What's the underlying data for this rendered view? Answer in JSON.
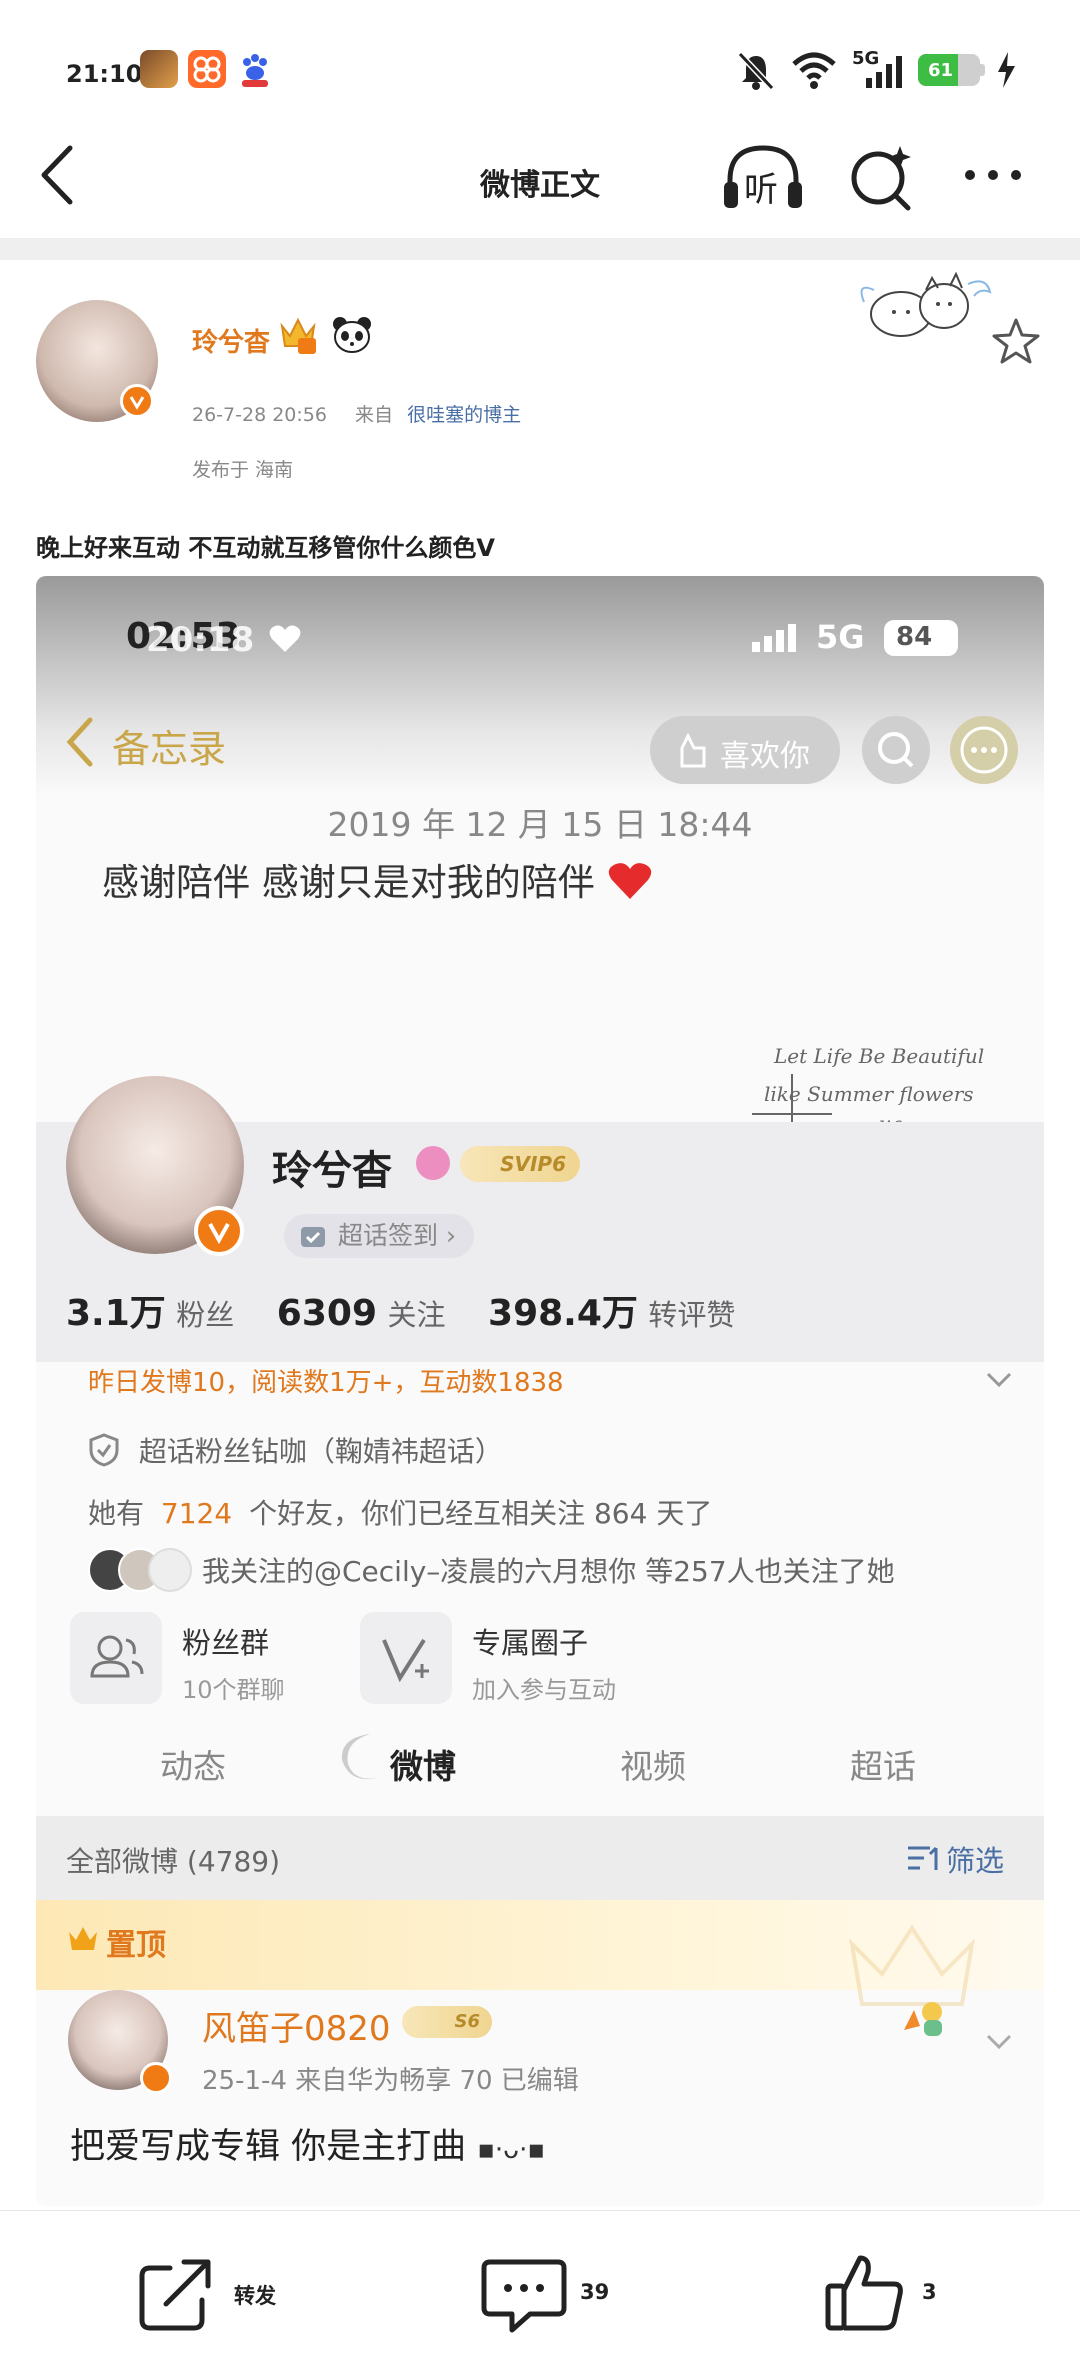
{
  "status_bar": {
    "time": "21:10",
    "network": "5G",
    "battery": "61",
    "app_icons": [
      "game-app-icon",
      "orange-app-icon",
      "baidu-app-icon"
    ],
    "status_icons": [
      "mute-icon",
      "wifi-icon",
      "signal-icon",
      "battery-icon",
      "charging-icon"
    ]
  },
  "nav": {
    "title": "微博正文",
    "listen_label": "听"
  },
  "post": {
    "username": "玲兮杳",
    "date": "26-7-28 20:56",
    "source_prefix": "来自",
    "source": "很哇塞的博主",
    "location": "发布于 海南",
    "text": "晚上好来互动 不互动就互移管你什么颜色V"
  },
  "screenshot": {
    "status_time": "02:53",
    "status_time_overlay": "20:18",
    "network": "5G",
    "battery": "84",
    "back_label": "备忘录",
    "like_button": "喜欢你",
    "memo_date": "2019 年 12 月 15 日 18:44",
    "memo_text": "感谢陪伴 感谢只是对我的陪伴",
    "handwriting": [
      "Let Life Be Beautiful",
      "like Summer flowers",
      "a life"
    ],
    "profile": {
      "name": "玲兮杳",
      "svip": "SVIP6",
      "checkin": "超话签到 ›",
      "fans_num": "3.1万",
      "fans_label": "粉丝",
      "follow_num": "6309",
      "follow_label": "关注",
      "likes_num": "398.4万",
      "likes_label": "转评赞",
      "activity": "昨日发博10，阅读数1万+，互动数1838",
      "supertopic": "超话粉丝钻咖（鞠婧祎超话）",
      "friends_prefix": "她有",
      "friends_count": "7124",
      "friends_suffix": "个好友，你们已经互相关注 864 天了",
      "mutual": "我关注的@Cecily–凌晨的六月想你 等257人也关注了她",
      "fan_group_title": "粉丝群",
      "fan_group_sub": "10个群聊",
      "circle_title": "专属圈子",
      "circle_sub": "加入参与互动"
    },
    "tabs": [
      "动态",
      "微博",
      "视频",
      "超话"
    ],
    "filter_left": "全部微博 (4789)",
    "filter_right": "筛选",
    "pinned": "置顶",
    "feed": {
      "name": "风笛子0820",
      "level": "S6",
      "meta": "25-1-4  来自华为畅享 70  已编辑",
      "text": "把爱写成专辑 你是主打曲"
    }
  },
  "bottom_bar": {
    "repost_label": "转发",
    "comment_count": "39",
    "like_count": "3"
  },
  "colors": {
    "accent_orange": "#e0781e",
    "link_blue": "#4a6fa5",
    "battery_green": "#3ebd44",
    "badge_orange": "#f07b14"
  }
}
